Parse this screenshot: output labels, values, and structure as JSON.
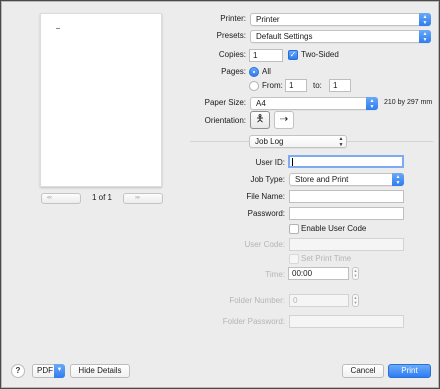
{
  "printer": {
    "label": "Printer:",
    "value": "Printer"
  },
  "presets": {
    "label": "Presets:",
    "value": "Default Settings"
  },
  "copies": {
    "label": "Copies:",
    "value": "1",
    "two_sided_label": "Two-Sided",
    "two_sided_checked": true
  },
  "pages": {
    "label": "Pages:",
    "all_label": "All",
    "from_label": "From:",
    "from_value": "1",
    "to_label": "to:",
    "to_value": "1"
  },
  "paper_size": {
    "label": "Paper Size:",
    "value": "A4",
    "dimensions": "210 by 297 mm"
  },
  "orientation": {
    "label": "Orientation:"
  },
  "section": {
    "value": "Job Log"
  },
  "job": {
    "user_id_label": "User ID:",
    "user_id_value": "",
    "job_type_label": "Job Type:",
    "job_type_value": "Store and Print",
    "file_name_label": "File Name:",
    "file_name_value": "",
    "password_label": "Password:",
    "password_value": "",
    "enable_user_code_label": "Enable User Code",
    "user_code_label": "User Code:",
    "set_print_time_label": "Set Print Time",
    "time_label": "Time:",
    "time_value": "00:00",
    "folder_number_label": "Folder Number:",
    "folder_number_value": "0",
    "folder_password_label": "Folder Password:"
  },
  "preview": {
    "page_indicator": "1 of 1",
    "prev_glyph": "«  ‹",
    "next_glyph": "›  »"
  },
  "footer": {
    "help_glyph": "?",
    "pdf_label": "PDF",
    "hide_details_label": "Hide Details",
    "cancel_label": "Cancel",
    "print_label": "Print"
  },
  "colors": {
    "accent": "#2f7cf0",
    "background": "#ececec"
  }
}
